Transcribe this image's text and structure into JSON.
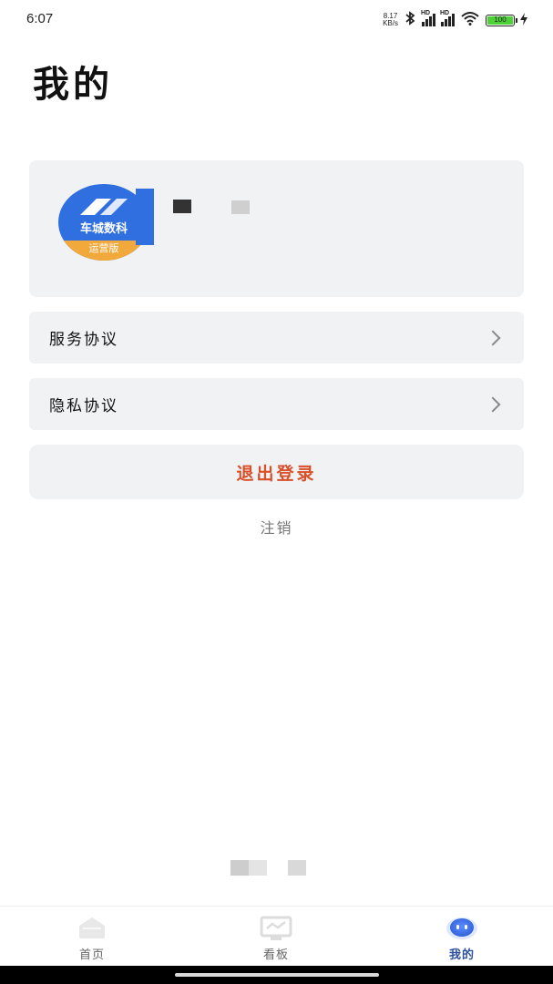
{
  "status_bar": {
    "time": "6:07",
    "net_speed_value": "8.17",
    "net_speed_unit": "KB/s",
    "signal_label": "HD",
    "battery_level": "100",
    "battery_color": "#4cd137"
  },
  "page": {
    "title": "我的"
  },
  "profile": {
    "logo_brand": "车城数科",
    "logo_edition": "运营版",
    "brand_color": "#2f6fe0",
    "edition_color": "#f2a93b"
  },
  "menu": [
    {
      "label": "服务协议",
      "icon": "chevron-right-icon"
    },
    {
      "label": "隐私协议",
      "icon": "chevron-right-icon"
    }
  ],
  "actions": {
    "logout_label": "退出登录",
    "logout_color": "#d7502a",
    "cancel_account_label": "注销"
  },
  "tab_bar": {
    "active_color": "#2b4f9b",
    "tabs": [
      {
        "label": "首页",
        "icon": "home-icon",
        "active": false
      },
      {
        "label": "看板",
        "icon": "dashboard-icon",
        "active": false
      },
      {
        "label": "我的",
        "icon": "profile-icon",
        "active": true
      }
    ]
  }
}
